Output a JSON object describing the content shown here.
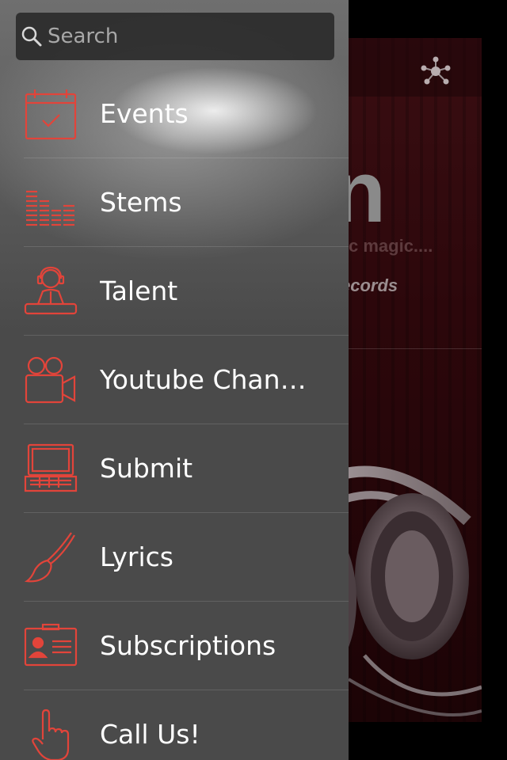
{
  "colors": {
    "accent": "#e2443a",
    "drawer_bg": "#4a4a4a",
    "label_text": "#ffffff"
  },
  "search": {
    "placeholder": "Search",
    "value": ""
  },
  "menu": [
    {
      "label": "Events",
      "icon": "calendar-icon"
    },
    {
      "label": "Stems",
      "icon": "equalizer-icon"
    },
    {
      "label": "Talent",
      "icon": "dj-icon"
    },
    {
      "label": "Youtube Chan…",
      "icon": "video-camera-icon"
    },
    {
      "label": "Submit",
      "icon": "laptop-icon"
    },
    {
      "label": "Lyrics",
      "icon": "paintbrush-icon"
    },
    {
      "label": "Subscriptions",
      "icon": "id-card-icon"
    },
    {
      "label": "Call Us!",
      "icon": "pointing-hand-icon"
    }
  ],
  "background_app": {
    "logo_letter": "n",
    "tagline": "c magic....",
    "label": "ecords",
    "share_icon": "share-network-icon"
  }
}
